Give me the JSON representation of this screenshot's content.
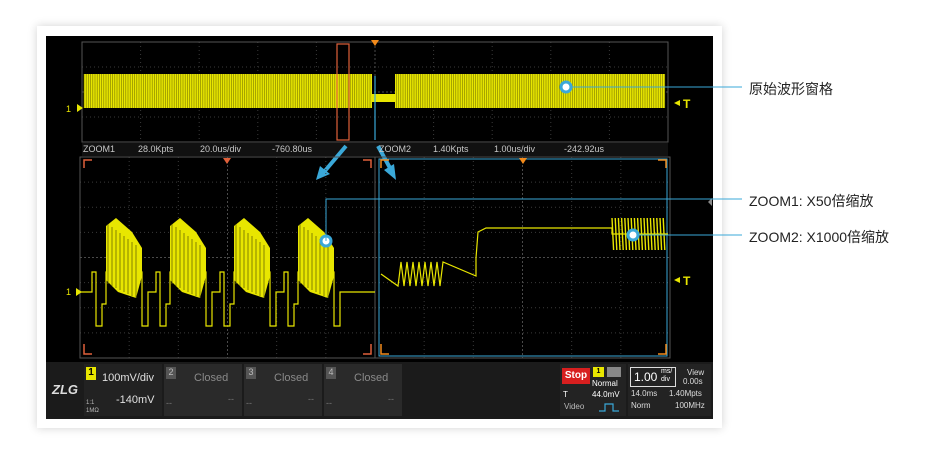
{
  "colors": {
    "trace": "#e8e600",
    "zoom1": "#e0603a",
    "zoom2": "#3aa8d8",
    "grid": "#3a3a3a",
    "accent": "#f28a1a"
  },
  "overview": {
    "ch_marker": "1",
    "trigger_marker": "T"
  },
  "zoom1_bar": {
    "name": "ZOOM1",
    "points": "28.0Kpts",
    "scale": "20.0us/div",
    "offset": "-760.80us"
  },
  "zoom2_bar": {
    "name": "ZOOM2",
    "points": "1.40Kpts",
    "scale": "1.00us/div",
    "offset": "-242.92us"
  },
  "zoom_pane": {
    "ch_marker": "1",
    "trigger_marker": "T"
  },
  "annotations": {
    "original": "原始波形窗格",
    "zoom1": "ZOOM1: X50倍缩放",
    "zoom2": "ZOOM2: X1000倍缩放"
  },
  "bottom": {
    "logo": "ZLG",
    "ch1": {
      "num": "1",
      "scale": "100mV/div",
      "offset": "-140mV",
      "coupling": "1:1",
      "impedance": "1MΩ"
    },
    "ch2": {
      "num": "2",
      "state": "Closed",
      "dashes": "--",
      "dashes2": "--"
    },
    "ch3": {
      "num": "3",
      "state": "Closed",
      "dashes": "--",
      "dashes2": "--"
    },
    "ch4": {
      "num": "4",
      "state": "Closed",
      "dashes": "--",
      "dashes2": "--"
    },
    "trigger": {
      "run": "Stop",
      "source": "1",
      "mode": "Normal",
      "type_label": "T",
      "level": "44.0mV",
      "kind": "Video"
    },
    "timebase": {
      "scale": "1.00",
      "unit_top": "ms/",
      "unit_bottom": "div",
      "view_label": "View",
      "view_value": "0.00s",
      "record": "14.0ms",
      "rate": "1.40Mpts",
      "acq_mode": "Norm",
      "bandwidth": "100MHz"
    }
  }
}
